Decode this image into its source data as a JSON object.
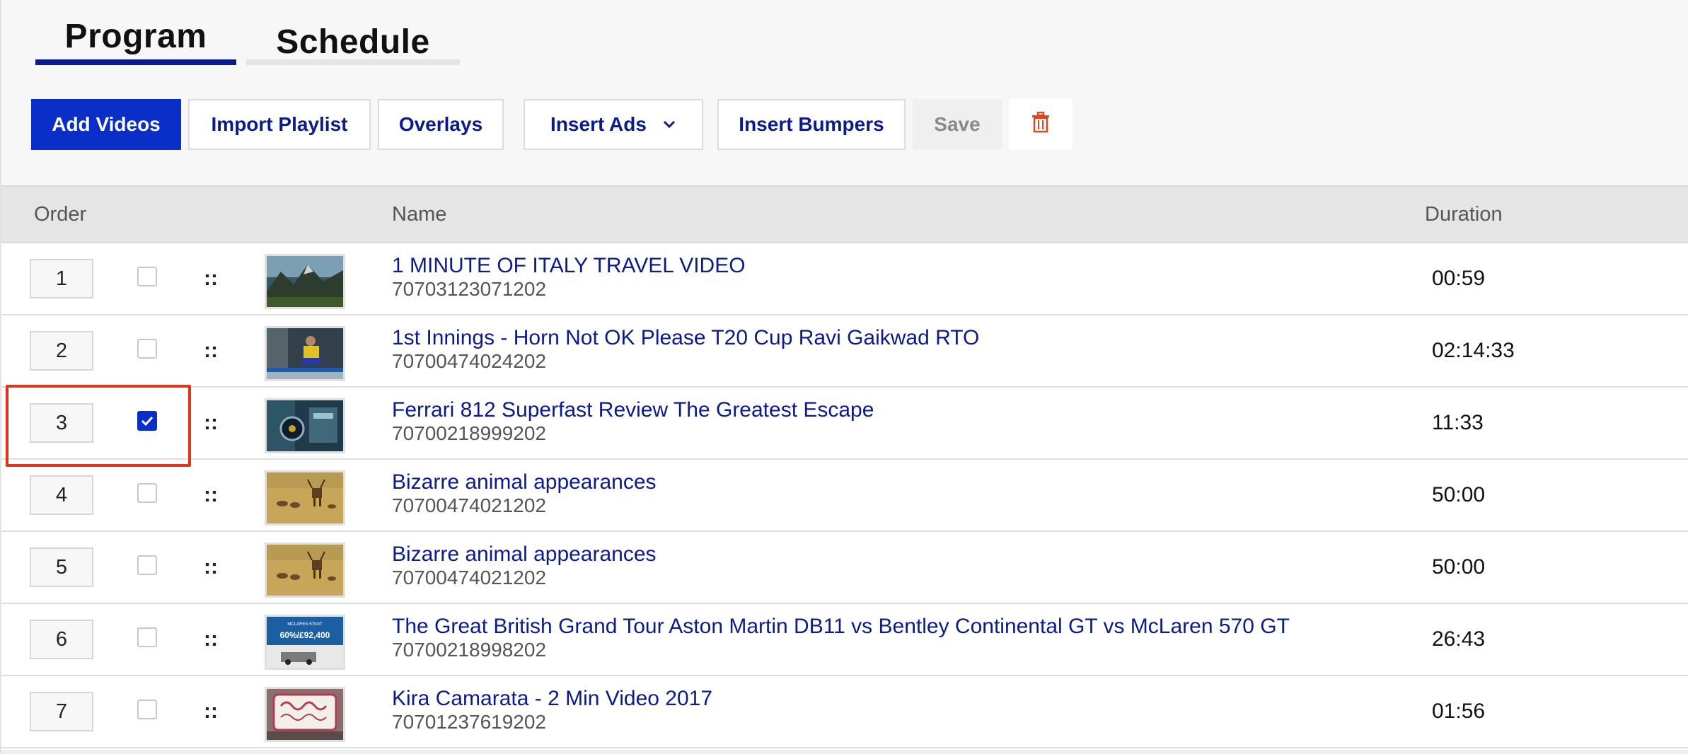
{
  "tabs": [
    {
      "label": "Program",
      "active": true
    },
    {
      "label": "Schedule",
      "active": false
    }
  ],
  "toolbar": {
    "add_videos": "Add Videos",
    "import_playlist": "Import Playlist",
    "overlays": "Overlays",
    "insert_ads": "Insert Ads",
    "insert_bumpers": "Insert Bumpers",
    "save": "Save",
    "delete_icon": "trash-icon"
  },
  "table": {
    "headers": {
      "order": "Order",
      "name": "Name",
      "duration": "Duration"
    },
    "rows": [
      {
        "order": "1",
        "checked": false,
        "handle": "::",
        "thumb": "mountain",
        "title": "1 MINUTE OF ITALY TRAVEL VIDEO",
        "id": "70703123071202",
        "duration": "00:59"
      },
      {
        "order": "2",
        "checked": false,
        "handle": "::",
        "thumb": "cricket",
        "title": "1st Innings - Horn Not OK Please T20 Cup Ravi Gaikwad RTO",
        "id": "70700474024202",
        "duration": "02:14:33"
      },
      {
        "order": "3",
        "checked": true,
        "handle": "::",
        "thumb": "car",
        "title": "Ferrari 812 Superfast Review The Greatest Escape",
        "id": "70700218999202",
        "duration": "11:33"
      },
      {
        "order": "4",
        "checked": false,
        "handle": "::",
        "thumb": "deer",
        "title": "Bizarre animal appearances",
        "id": "70700474021202",
        "duration": "50:00"
      },
      {
        "order": "5",
        "checked": false,
        "handle": "::",
        "thumb": "deer",
        "title": "Bizarre animal appearances",
        "id": "70700474021202",
        "duration": "50:00"
      },
      {
        "order": "6",
        "checked": false,
        "handle": "::",
        "thumb": "sale",
        "title": "The Great British Grand Tour Aston Martin DB11 vs Bentley Continental GT vs McLaren 570 GT",
        "id": "70700218998202",
        "duration": "26:43"
      },
      {
        "order": "7",
        "checked": false,
        "handle": "::",
        "thumb": "sign",
        "title": "Kira Camarata - 2 Min Video 2017",
        "id": "70701237619202",
        "duration": "01:56"
      }
    ]
  },
  "thumb_texts": {
    "sale": "60%/£92,400",
    "sale_top": "MCLAREN 570GT"
  },
  "colors": {
    "primary": "#0a2fc9",
    "link": "#0b1b8a",
    "highlight": "#e0341c",
    "delete": "#d9481f"
  }
}
